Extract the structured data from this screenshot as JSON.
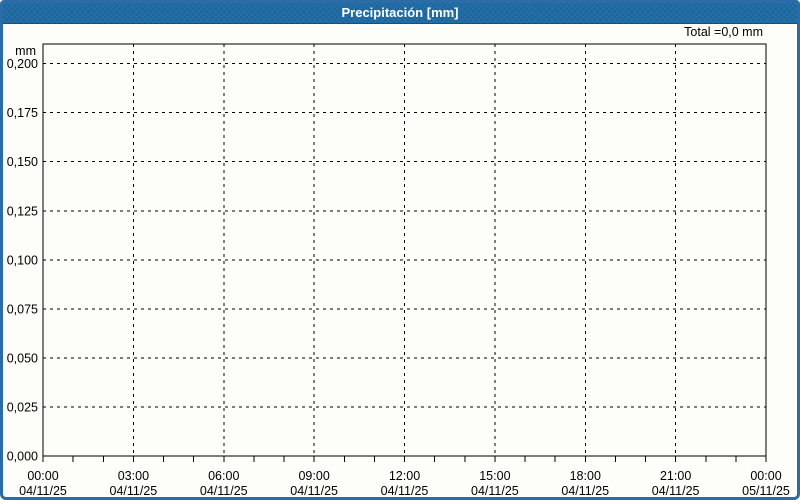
{
  "header": {
    "title": "Precipitación [mm]",
    "total_label": "Total =0,0 mm"
  },
  "chart_data": {
    "type": "line",
    "title": "Precipitación [mm]",
    "ylabel": "mm",
    "xlabel": "",
    "ylim": [
      0,
      0.21
    ],
    "grid": "dashed",
    "legend": "none",
    "total": "0,0 mm",
    "y_ticks": [
      {
        "value": 0.2,
        "label": "0,200"
      },
      {
        "value": 0.175,
        "label": "0,175"
      },
      {
        "value": 0.15,
        "label": "0,150"
      },
      {
        "value": 0.125,
        "label": "0,125"
      },
      {
        "value": 0.1,
        "label": "0,100"
      },
      {
        "value": 0.075,
        "label": "0,075"
      },
      {
        "value": 0.05,
        "label": "0,050"
      },
      {
        "value": 0.025,
        "label": "0,025"
      },
      {
        "value": 0.0,
        "label": "0,000"
      }
    ],
    "x_ticks": [
      {
        "hour": 0,
        "time": "00:00",
        "date": "04/11/25"
      },
      {
        "hour": 3,
        "time": "03:00",
        "date": "04/11/25"
      },
      {
        "hour": 6,
        "time": "06:00",
        "date": "04/11/25"
      },
      {
        "hour": 9,
        "time": "09:00",
        "date": "04/11/25"
      },
      {
        "hour": 12,
        "time": "12:00",
        "date": "04/11/25"
      },
      {
        "hour": 15,
        "time": "15:00",
        "date": "04/11/25"
      },
      {
        "hour": 18,
        "time": "18:00",
        "date": "04/11/25"
      },
      {
        "hour": 21,
        "time": "21:00",
        "date": "04/11/25"
      },
      {
        "hour": 24,
        "time": "00:00",
        "date": "05/11/25"
      }
    ],
    "x_hours_total": 24,
    "x_minor_tick_hours": 1,
    "series": [
      {
        "name": "Precipitación",
        "values": [
          0,
          0,
          0,
          0,
          0,
          0,
          0,
          0,
          0
        ]
      }
    ],
    "colors": {
      "titlebar_bg": "#1f6ba4",
      "titlebar_text": "#ffffff",
      "window_border": "#2b6ca6",
      "grid": "#000000",
      "axis": "#000000",
      "text": "#000000",
      "background": "#fdfdfa"
    }
  }
}
